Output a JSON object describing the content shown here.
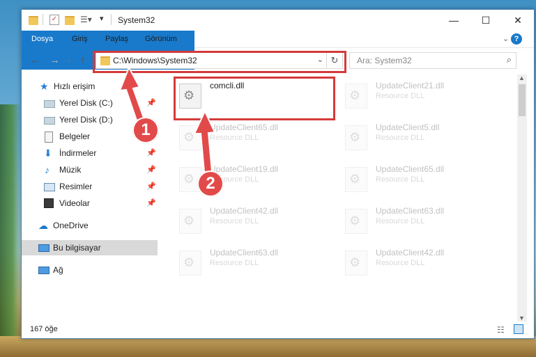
{
  "window": {
    "title": "System32"
  },
  "ribbon": {
    "tabs": [
      "Dosya",
      "Giriş",
      "Paylaş",
      "Görünüm"
    ]
  },
  "address": {
    "path": "C:\\Windows\\System32"
  },
  "search": {
    "placeholder": "Ara: System32"
  },
  "sidebar": {
    "items": [
      {
        "label": "Hızlı erişim",
        "icon": "star-icon"
      },
      {
        "label": "Yerel Disk (C:)",
        "icon": "drive-icon",
        "pinned": true
      },
      {
        "label": "Yerel Disk (D:)",
        "icon": "drive-icon"
      },
      {
        "label": "Belgeler",
        "icon": "documents-icon"
      },
      {
        "label": "İndirmeler",
        "icon": "download-icon",
        "pinned": true
      },
      {
        "label": "Müzik",
        "icon": "music-icon",
        "pinned": true
      },
      {
        "label": "Resimler",
        "icon": "pictures-icon",
        "pinned": true
      },
      {
        "label": "Videolar",
        "icon": "videos-icon",
        "pinned": true
      },
      {
        "label": "OneDrive",
        "icon": "cloud-icon"
      },
      {
        "label": "Bu bilgisayar",
        "icon": "computer-icon",
        "selected": true
      },
      {
        "label": "Ağ",
        "icon": "network-icon"
      }
    ]
  },
  "files": [
    {
      "name": "comcli.dll",
      "type": ""
    },
    {
      "name": "UpdateClient21.dll",
      "type": "Resource DLL"
    },
    {
      "name": "UpdateClient65.dll",
      "type": "Resource DLL"
    },
    {
      "name": "UpdateClient5.dll",
      "type": "Resource DLL"
    },
    {
      "name": "UpdateClient19.dll",
      "type": "Resource DLL"
    },
    {
      "name": "UpdateClient65.dll",
      "type": "Resource DLL"
    },
    {
      "name": "UpdateClient42.dll",
      "type": "Resource DLL"
    },
    {
      "name": "UpdateClient63.dll",
      "type": "Resource DLL"
    },
    {
      "name": "UpdateClient63.dll",
      "type": "Resource DLL"
    },
    {
      "name": "UpdateClient42.dll",
      "type": "Resource DLL"
    }
  ],
  "status": {
    "count": "167 öğe"
  },
  "callouts": [
    "1",
    "2"
  ],
  "colors": {
    "accent": "#1979ca",
    "highlight": "#d43a3a"
  }
}
